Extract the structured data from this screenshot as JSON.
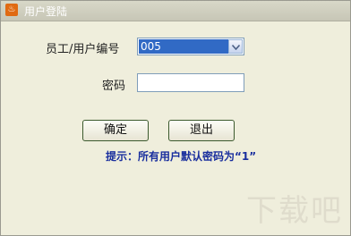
{
  "window": {
    "title": "用户登陆",
    "icon": "app-logo-icon"
  },
  "form": {
    "user_label": "员工/用户编号",
    "user_value": "005",
    "password_label": "密码",
    "password_value": ""
  },
  "buttons": {
    "confirm": "确定",
    "exit": "退出"
  },
  "hint": "提示：所有用户默认密码为“1”",
  "watermark": "下载吧",
  "colors": {
    "hint_text": "#1a2f9e",
    "selection": "#316ac5"
  }
}
